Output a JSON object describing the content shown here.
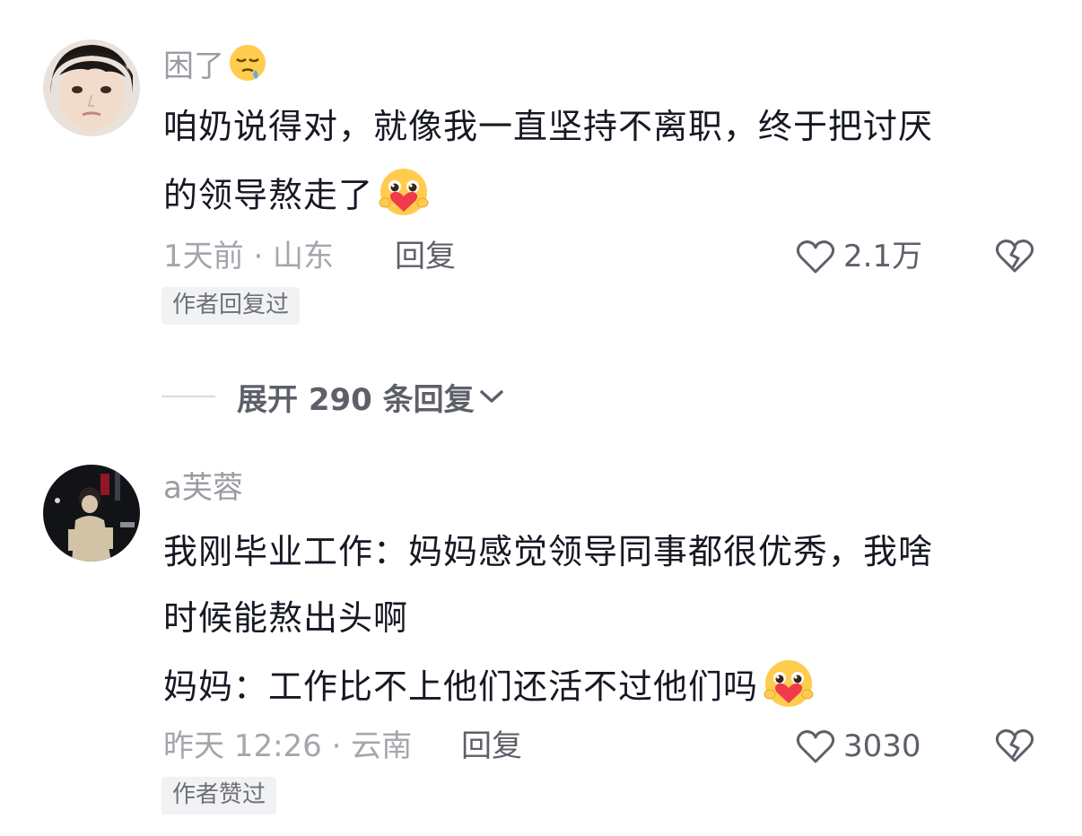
{
  "comments": [
    {
      "username": "困了",
      "username_emoji": "sleepy-face-emoji",
      "lines": [
        "咱奶说得对，就像我一直坚持不离职，终于把讨厌",
        "的领导熬走了"
      ],
      "text_emoji": "hugging-heart-face-emoji",
      "meta": "1天前 · 山东",
      "reply_label": "回复",
      "like_count": "2.1万",
      "tag": "作者回复过"
    },
    {
      "username": "a芙蓉",
      "lines": [
        "我刚毕业工作：妈妈感觉领导同事都很优秀，我啥",
        "时候能熬出头啊",
        "妈妈：工作比不上他们还活不过他们吗"
      ],
      "text_emoji": "hugging-heart-face-emoji",
      "meta": "昨天 12:26 · 云南",
      "reply_label": "回复",
      "like_count": "3030",
      "tag": "作者赞过"
    }
  ],
  "expand_replies": "展开 290 条回复",
  "icons": {
    "like": "heart-outline-icon",
    "dislike": "broken-heart-icon",
    "expand": "chevron-down-icon"
  },
  "colors": {
    "text": "#161823",
    "meta": "#a5a6ad",
    "secondary": "#5e6069",
    "tag_bg": "#f1f2f4"
  }
}
